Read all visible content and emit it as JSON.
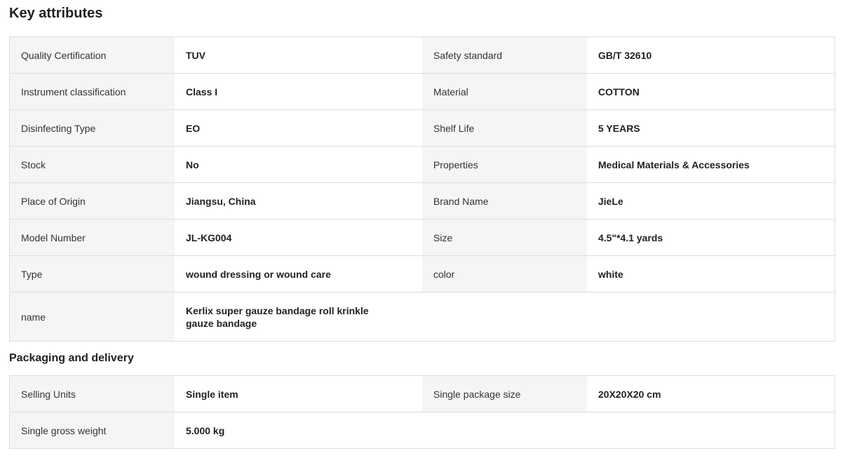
{
  "key_attributes": {
    "title": "Key attributes",
    "rows": [
      [
        "Quality Certification",
        "TUV",
        "Safety standard",
        "GB/T 32610"
      ],
      [
        "Instrument classification",
        "Class I",
        "Material",
        "COTTON"
      ],
      [
        "Disinfecting Type",
        "EO",
        "Shelf Life",
        "5 YEARS"
      ],
      [
        "Stock",
        "No",
        "Properties",
        "Medical Materials & Accessories"
      ],
      [
        "Place of Origin",
        "Jiangsu, China",
        "Brand Name",
        "JieLe"
      ],
      [
        "Model Number",
        "JL-KG004",
        "Size",
        "4.5\"*4.1 yards"
      ],
      [
        "Type",
        "wound dressing or wound care",
        "color",
        "white"
      ],
      [
        "name",
        "Kerlix super gauze bandage roll krinkle gauze bandage",
        "",
        ""
      ]
    ]
  },
  "packaging": {
    "title": "Packaging and delivery",
    "rows": [
      [
        "Selling Units",
        "Single item",
        "Single package size",
        "20X20X20 cm"
      ],
      [
        "Single gross weight",
        "5.000 kg",
        "",
        ""
      ]
    ]
  }
}
